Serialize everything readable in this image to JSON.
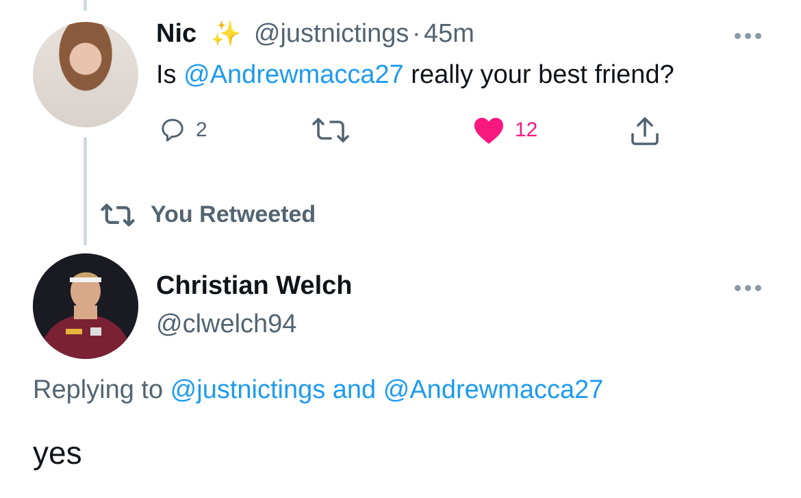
{
  "tweet1": {
    "name": "Nic",
    "emoji": "✨",
    "handle": "@justnictings",
    "separator": "·",
    "time": "45m",
    "text_prefix": "Is ",
    "mention": "@Andrewmacca27",
    "text_suffix": " really your best friend?",
    "reply_count": "2",
    "like_count": "12",
    "like_color": "#f91880"
  },
  "retweet_banner": {
    "label": "You Retweeted"
  },
  "tweet2": {
    "name": "Christian Welch",
    "handle": "@clwelch94",
    "replying_prefix": "Replying to ",
    "reply_to_1": "@justnictings",
    "and_word": " and ",
    "reply_to_2": "@Andrewmacca27",
    "body": "yes"
  },
  "colors": {
    "link": "#1d9bf0",
    "muted": "#536471",
    "text": "#0f1419"
  },
  "icons": {
    "reply": "reply-icon",
    "retweet": "retweet-icon",
    "like": "heart-icon",
    "share": "share-icon",
    "more": "more-icon"
  }
}
